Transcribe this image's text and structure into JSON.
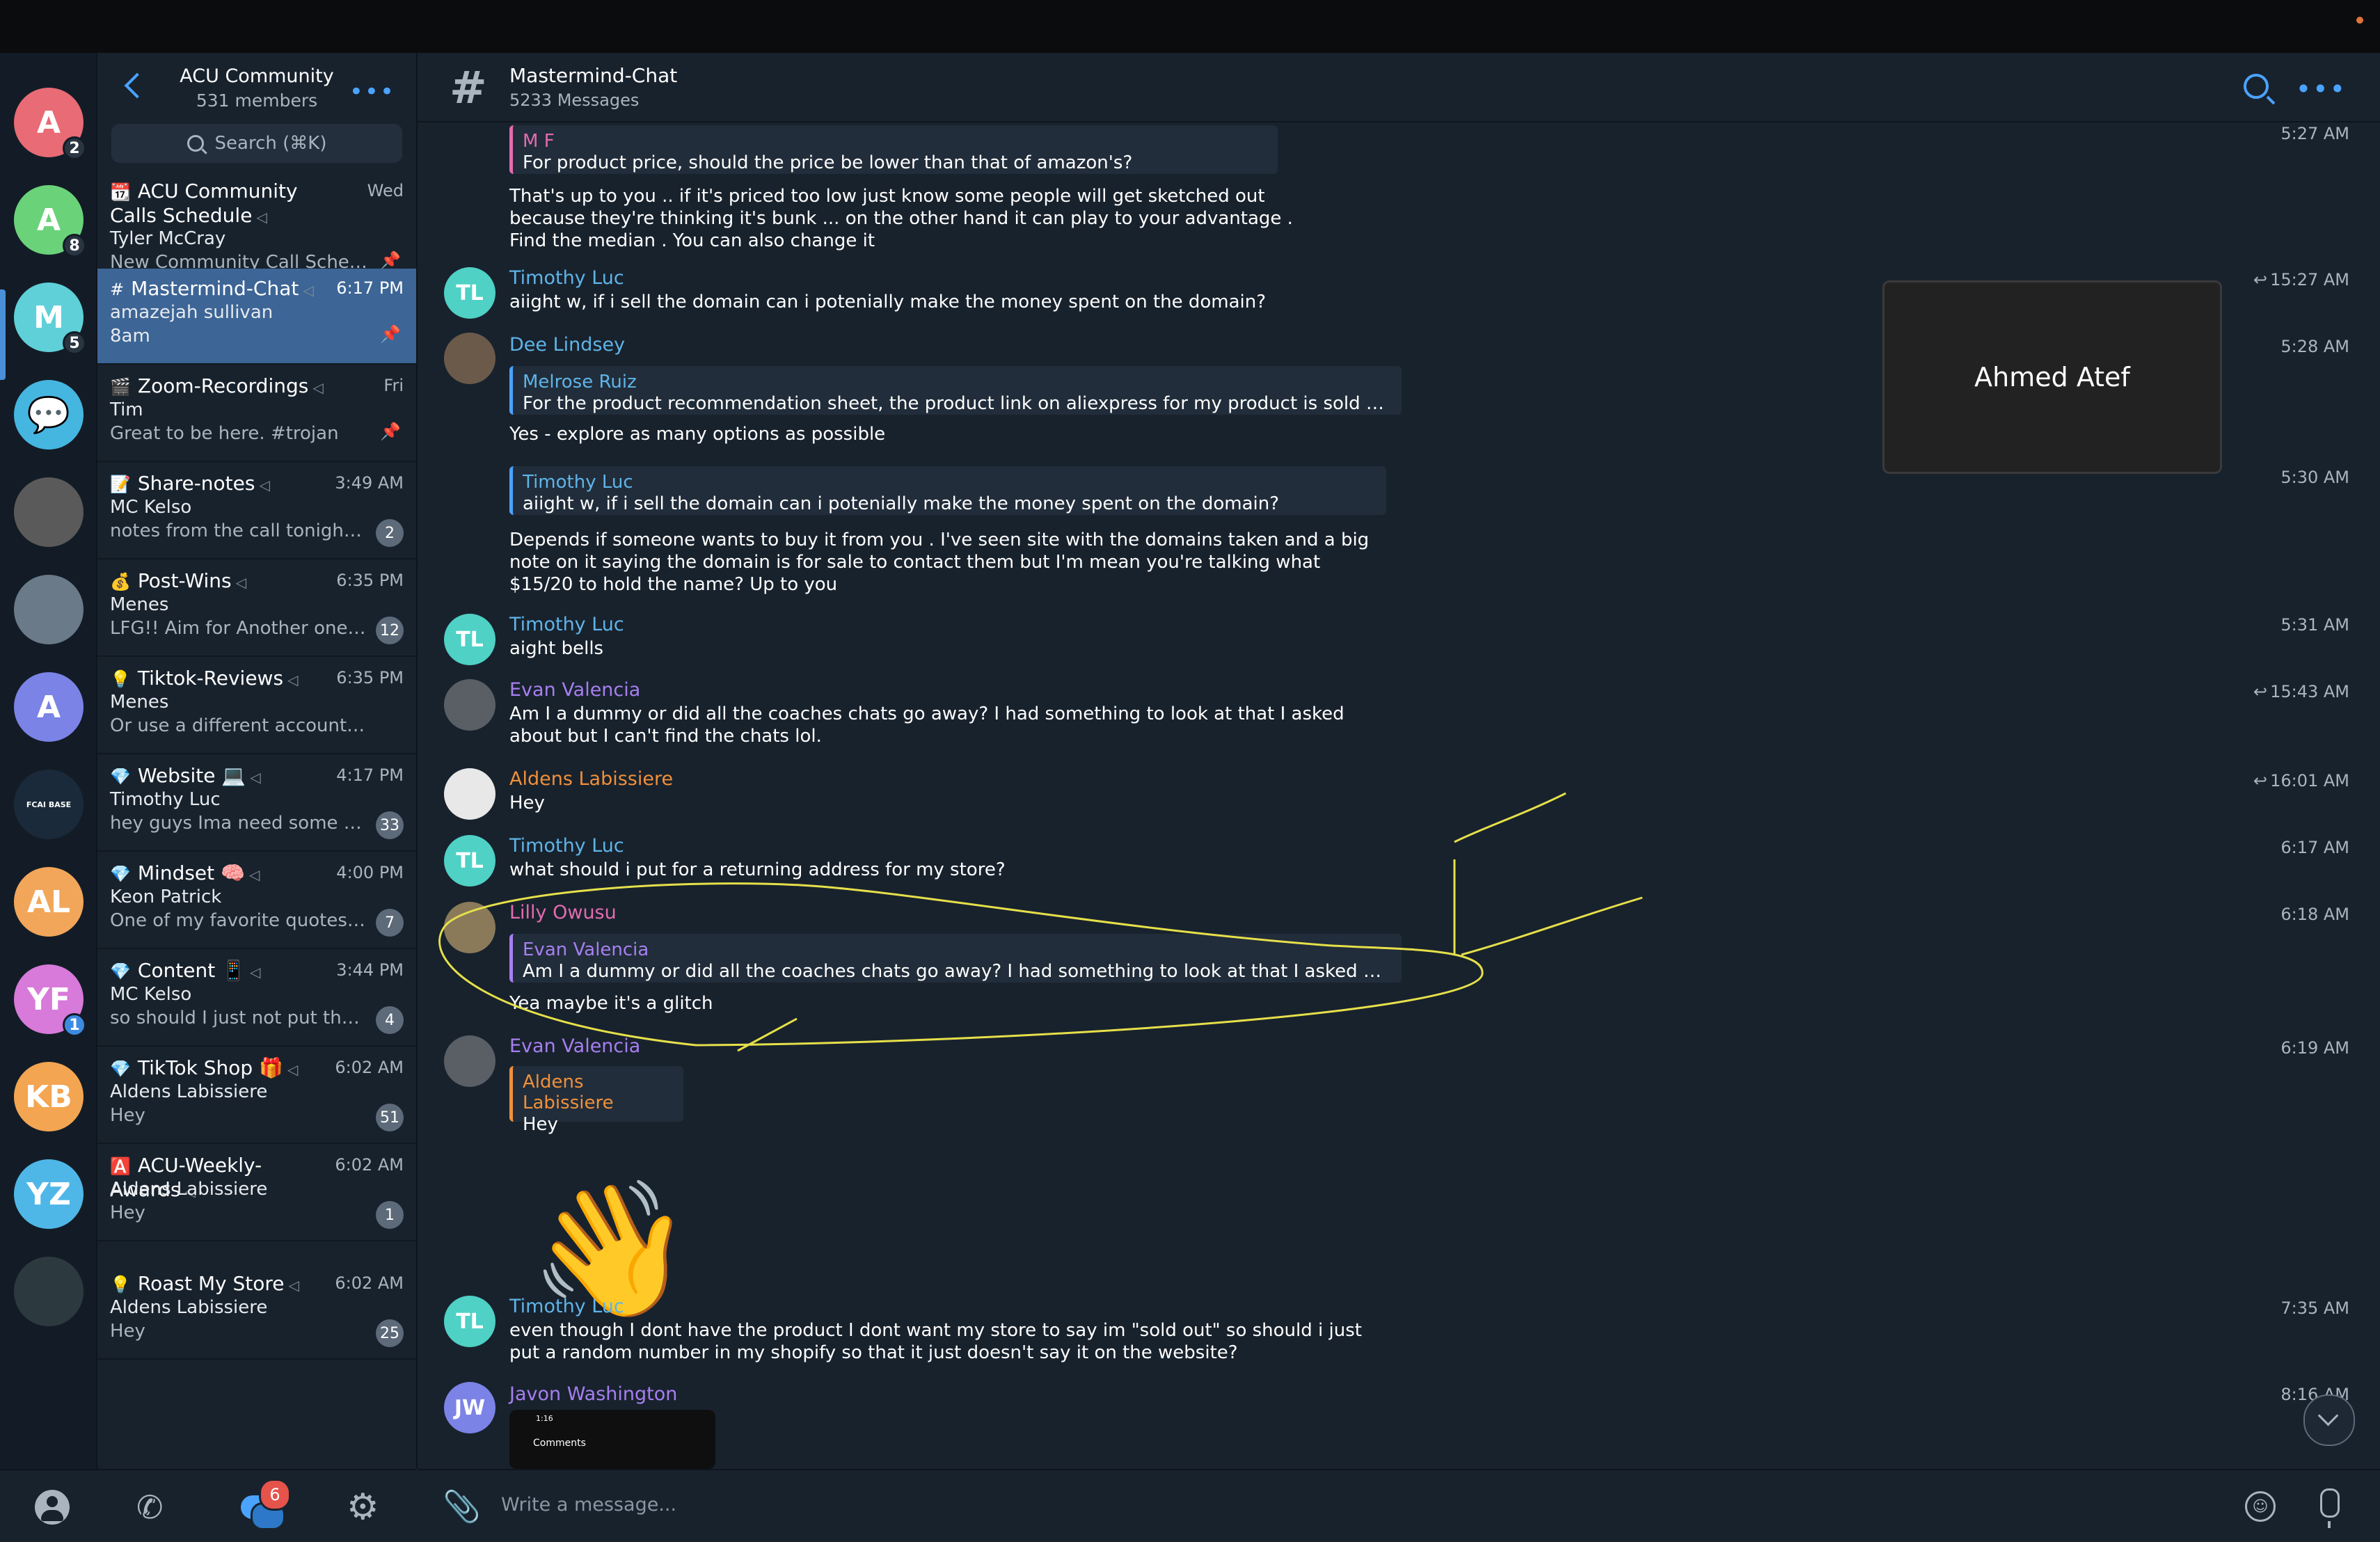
{
  "sidebar_rail": {
    "avatars": [
      {
        "label": "A",
        "color": "#e86b75",
        "badge": "2"
      },
      {
        "label": "A",
        "color": "#6ad37a",
        "badge": "8"
      },
      {
        "label": "M",
        "color": "#5fd0d8",
        "badge": "5"
      },
      {
        "label": "",
        "color": "#45b6e0",
        "icon": "chat-bubbles-icon"
      },
      {
        "label": "",
        "color": "#5a5a5a",
        "icon": "profile-photo"
      },
      {
        "label": "",
        "color": "#6b7a88",
        "icon": "profile-photo"
      },
      {
        "label": "A",
        "color": "#7b83e6"
      },
      {
        "label": "FCAI BASE",
        "color": "#1a2a3a"
      },
      {
        "label": "AL",
        "color": "#f2a65a"
      },
      {
        "label": "YF",
        "color": "#d77ad9",
        "badge": "1"
      },
      {
        "label": "KB",
        "color": "#f3a552"
      },
      {
        "label": "YZ",
        "color": "#4fb7e8"
      },
      {
        "label": "",
        "color": "#2c3a40",
        "icon": "profile-photo"
      }
    ]
  },
  "chat_list": {
    "title": "ACU Community",
    "subtitle": "531 members",
    "search_placeholder": "Search (⌘K)",
    "items": [
      {
        "icon": "📆",
        "name": "ACU Community Calls Schedule",
        "time": "Wed",
        "sender": "Tyler McCray",
        "message": "New Community Call Schedul...",
        "pinned": true
      },
      {
        "icon": "#",
        "name": "Mastermind-Chat",
        "time": "6:17 PM",
        "sender": "amazejah sullivan",
        "message": "8am",
        "pinned": true,
        "selected": true
      },
      {
        "icon": "🎬",
        "name": "Zoom-Recordings",
        "time": "Fri",
        "sender": "Tim",
        "message": "Great to be here. #trojan",
        "pinned": true
      },
      {
        "icon": "📝",
        "name": "Share-notes",
        "time": "3:49 AM",
        "sender": "MC Kelso",
        "message": "notes from the call tonight! g...",
        "count": "2"
      },
      {
        "icon": "💰",
        "name": "Post-Wins",
        "time": "6:35 PM",
        "sender": "Menes",
        "message": "LFG!! Aim for Another one to...",
        "count": "12"
      },
      {
        "icon": "💡",
        "name": "Tiktok-Reviews",
        "time": "6:35 PM",
        "sender": "Menes",
        "message": "Or use a different account to che...",
        "count": ""
      },
      {
        "icon": "💎",
        "name": "Website 💻",
        "time": "4:17 PM",
        "sender": "Timothy Luc",
        "message": "hey guys Ima need some hel...",
        "count": "33"
      },
      {
        "icon": "💎",
        "name": "Mindset 🧠",
        "time": "4:00 PM",
        "sender": "Keon Patrick",
        "message": "One of my favorite quotes of...",
        "count": "7"
      },
      {
        "icon": "💎",
        "name": "Content 📱",
        "time": "3:44 PM",
        "sender": "MC Kelso",
        "message": "so should I just not put the li...",
        "count": "4"
      },
      {
        "icon": "💎",
        "name": "TikTok Shop 🎁",
        "time": "6:02 AM",
        "sender": "Aldens Labissiere",
        "message": "Hey",
        "count": "51"
      },
      {
        "icon": "🅰️",
        "name": "ACU-Weekly-Awards",
        "time": "6:02 AM",
        "sender": "Aldens Labissiere",
        "message": "Hey",
        "count": "1"
      },
      {
        "icon": "💡",
        "name": "Roast My Store",
        "time": "6:02 AM",
        "sender": "Aldens Labissiere",
        "message": "Hey",
        "count": "25"
      }
    ]
  },
  "channel": {
    "title": "Mastermind-Chat",
    "subtitle": "5233 Messages"
  },
  "messages": [
    {
      "id": "m1",
      "quote_name": "M F",
      "quote_text": "For product price, should the price be lower than that of amazon's?",
      "text": "That's up to you .. if it's priced too low just know some people will get sketched out because they're thinking it's bunk ... on the other hand it can play to your advantage . Find the median . You can also change it",
      "time": "5:27 AM"
    },
    {
      "id": "m2",
      "name": "Timothy Luc",
      "initials": "TL",
      "text": "aiight w, if i sell the domain can i potenially make the money spent on the domain?",
      "time": "15:27 AM",
      "forwarded": true
    },
    {
      "id": "m3",
      "name": "Dee Lindsey",
      "quote_name": "Melrose Ruiz",
      "quote_text": "For the product recommendation sheet, the product link on aliexpress for my product is sold out , coul...",
      "text": "Yes - explore as many options as possible",
      "time": "5:28 AM"
    },
    {
      "id": "m4",
      "quote_name": "Timothy Luc",
      "quote_text": "aiight w, if i sell the domain can i potenially make the money spent on the domain?",
      "text": "Depends if someone wants to buy it from you . I've seen site with the domains taken and a big note on it saying the domain is for sale to contact them but I'm mean you're talking what $15/20 to hold the name? Up to you",
      "time": "5:30 AM"
    },
    {
      "id": "m5",
      "name": "Timothy Luc",
      "initials": "TL",
      "text": "aight bells",
      "time": "5:31 AM"
    },
    {
      "id": "m6",
      "name": "Evan Valencia",
      "text": "Am I a dummy or did all the coaches chats go away? I had something to look at that I asked about but I can't find the chats lol.",
      "time": "15:43 AM",
      "forwarded": true
    },
    {
      "id": "m7",
      "name": "Aldens Labissiere",
      "text": "Hey",
      "time": "16:01 AM",
      "forwarded": true
    },
    {
      "id": "m8",
      "name": "Timothy Luc",
      "initials": "TL",
      "text": "what should i put for a returning address for my store?",
      "time": "6:17 AM"
    },
    {
      "id": "m9",
      "name": "Lilly Owusu",
      "quote_name": "Evan Valencia",
      "quote_text": "Am I a dummy or did all the coaches chats go away? I had something to look at that I asked about but I...",
      "text": "Yea maybe it's a glitch",
      "time": "6:18 AM"
    },
    {
      "id": "m10",
      "name": "Evan Valencia",
      "quote_name": "Aldens Labissiere",
      "quote_text": "Hey",
      "time": "6:19 AM",
      "sticker": "👋"
    },
    {
      "id": "m11",
      "name": "Timothy Luc",
      "initials": "TL",
      "text": "even though I dont have the product I dont want my store to say im \"sold out\" so should i just put a random number in my shopify so that it just doesn't say it on the website?",
      "time": "7:35 AM"
    },
    {
      "id": "m12",
      "name": "Javon Washington",
      "initials": "JW",
      "time": "8:16 AM",
      "thumb_time": "1:16",
      "thumb_label": "Comments"
    }
  ],
  "video_call": {
    "participant": "Ahmed Atef"
  },
  "composer": {
    "placeholder": "Write a message..."
  },
  "tabbar": {
    "chats_badge": "6"
  },
  "colors": {
    "accent": "#4aa3ff",
    "selected_row": "#3d6596",
    "name_blue": "#5fb4e8",
    "name_purple": "#a77ff0",
    "name_orange": "#f0903a",
    "name_pink": "#e46bb0",
    "annotation_yellow": "#e6e04a"
  }
}
